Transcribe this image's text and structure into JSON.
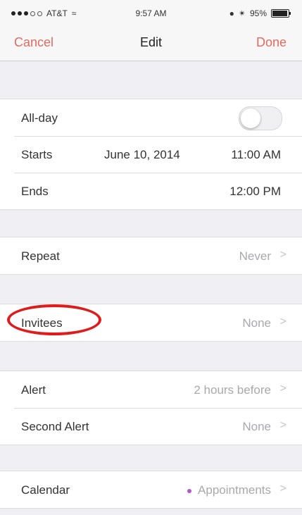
{
  "status_bar": {
    "carrier": "AT&T",
    "time": "9:57 AM",
    "battery": "95%",
    "battery_level": 0.95
  },
  "nav": {
    "cancel": "Cancel",
    "title": "Edit",
    "done": "Done"
  },
  "colors": {
    "accent": "#e06b5f",
    "highlight_circle": "#e01b1b",
    "calendar_dot": "#b05cc8"
  },
  "all_day": {
    "label": "All-day",
    "on": false
  },
  "starts": {
    "label": "Starts",
    "date": "June 10, 2014",
    "time": "11:00 AM"
  },
  "ends": {
    "label": "Ends",
    "time": "12:00 PM"
  },
  "repeat": {
    "label": "Repeat",
    "value": "Never"
  },
  "invitees": {
    "label": "Invitees",
    "value": "None"
  },
  "alert": {
    "label": "Alert",
    "value": "2 hours before"
  },
  "second_alert": {
    "label": "Second Alert",
    "value": "None"
  },
  "calendar": {
    "label": "Calendar",
    "value": "Appointments"
  },
  "chevron": ">"
}
